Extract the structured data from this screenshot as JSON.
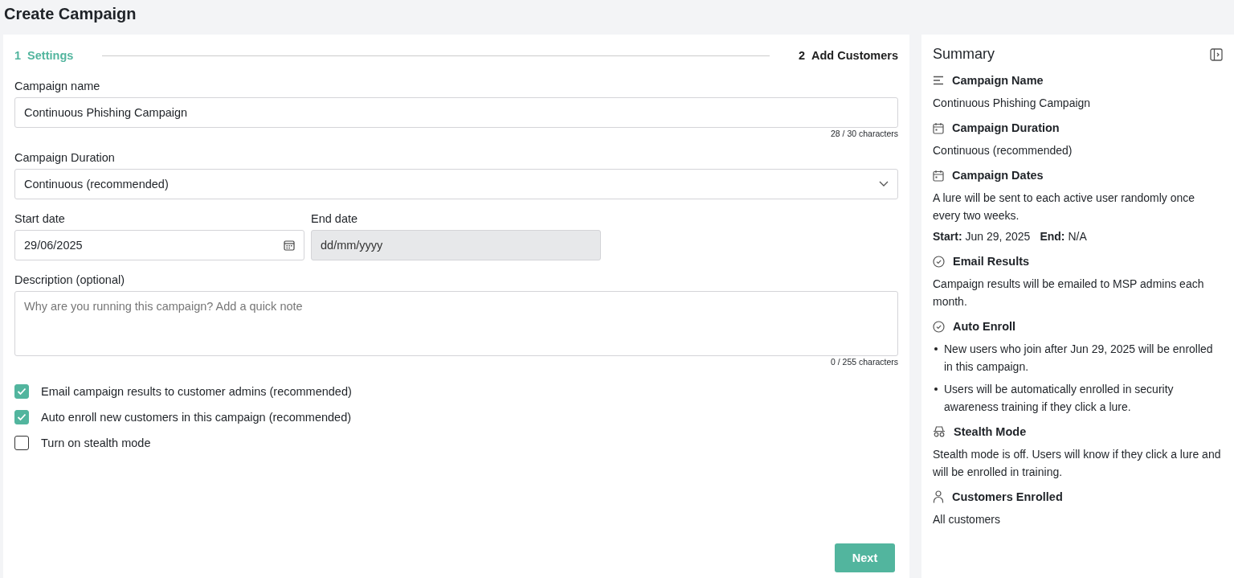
{
  "page_title": "Create Campaign",
  "steps": [
    {
      "number": "1",
      "label": "Settings",
      "selected": true
    },
    {
      "number": "2",
      "label": "Add Customers",
      "selected": false
    }
  ],
  "campaign_name": {
    "label": "Campaign name",
    "value": "Continuous Phishing Campaign",
    "counter": "28 / 30 characters"
  },
  "campaign_duration": {
    "label": "Campaign Duration",
    "value": "Continuous (recommended)"
  },
  "start_date": {
    "label": "Start date",
    "value": "29/06/2025"
  },
  "end_date": {
    "label": "End date",
    "placeholder": "dd/mm/yyyy",
    "disabled": true
  },
  "description": {
    "label": "Description (optional)",
    "placeholder": "Why are you running this campaign? Add a quick note",
    "counter": "0 / 255 characters"
  },
  "options": [
    {
      "label": "Email campaign results to customer admins (recommended)",
      "checked": true
    },
    {
      "label": "Auto enroll new customers in this campaign (recommended)",
      "checked": true
    },
    {
      "label": "Turn on stealth mode",
      "checked": false
    }
  ],
  "next_button": "Next",
  "summary": {
    "title": "Summary",
    "sections": [
      {
        "kind": "text",
        "title": "Campaign Name",
        "text": "Continuous Phishing Campaign"
      },
      {
        "kind": "text",
        "title": "Campaign Duration",
        "text": "Continuous (recommended)"
      },
      {
        "kind": "dates",
        "title": "Campaign Dates",
        "text": "A lure will be sent to each active user randomly once every two weeks.",
        "start": "**Start:** Jun 29, 2025",
        "end": "**End:** N/A"
      },
      {
        "kind": "text",
        "title": "Email Results",
        "text": "Campaign results will be emailed to MSP admins each month."
      },
      {
        "kind": "bullets",
        "title": "Auto Enroll",
        "bullets": [
          "New users who join after Jun 29, 2025 will be enrolled in this campaign.",
          "Users will be automatically enrolled in security awareness training if they click a lure."
        ]
      },
      {
        "kind": "text",
        "title": "Stealth Mode",
        "text": "Stealth mode is off. Users will know if they click a lure and will be enrolled in training."
      },
      {
        "kind": "text",
        "title": "Customers Enrolled",
        "text": "All customers"
      }
    ]
  }
}
